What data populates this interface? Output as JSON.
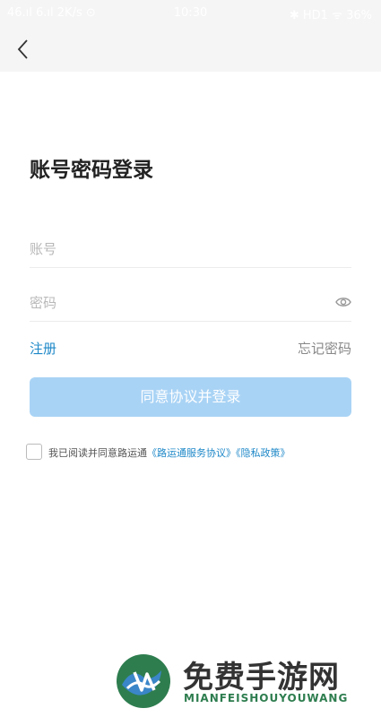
{
  "statusbar": {
    "left": "46.ıl 6.ıl 2K/s ⊙",
    "time": "10:30",
    "right": "✱ HD1 ᯤ 36%"
  },
  "page": {
    "title": "账号密码登录"
  },
  "form": {
    "account_placeholder": "账号",
    "password_placeholder": "密码",
    "register_label": "注册",
    "forgot_label": "忘记密码",
    "login_label": "同意协议并登录"
  },
  "agreement": {
    "prefix": "我已阅读并同意路运通",
    "service_link": "《路运通服务协议》",
    "privacy_link": "《隐私政策》",
    "checked": false
  },
  "watermark": {
    "cn": "免费手游网",
    "en": "MIANFEISHOUYOUWANG"
  },
  "colors": {
    "accent": "#1e88c8",
    "button_disabled": "#a9d3f5"
  }
}
